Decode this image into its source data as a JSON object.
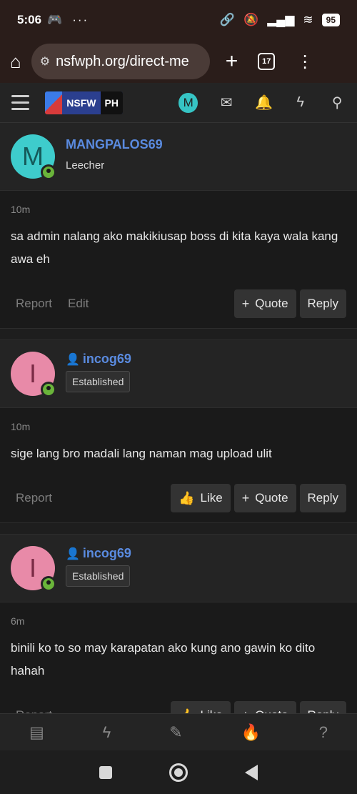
{
  "status_bar": {
    "time": "5:06",
    "dots": "···",
    "battery": "95"
  },
  "browser": {
    "url": "nsfwph.org/direct-me",
    "tabs_count": "17",
    "plus": "+",
    "kebab": "⋮"
  },
  "site": {
    "logo_nsfw": "NSFW",
    "logo_ph": "PH",
    "user_initial": "M"
  },
  "posts": [
    {
      "initial": "M",
      "username": "MANGPALOS69",
      "user_title": "Leecher",
      "timestamp": "10m",
      "message": "sa admin nalang ako makikiusap boss di kita kaya wala kang awa eh",
      "report": "Report",
      "edit": "Edit",
      "quote": "Quote",
      "reply": "Reply"
    },
    {
      "initial": "I",
      "username": "incog69",
      "badge": "Established",
      "timestamp": "10m",
      "message": "sige lang bro madali lang naman mag upload ulit",
      "report": "Report",
      "like": "Like",
      "quote": "Quote",
      "reply": "Reply"
    },
    {
      "initial": "I",
      "username": "incog69",
      "badge": "Established",
      "timestamp": "6m",
      "message": "binili ko to so may karapatan ako kung ano gawin ko dito hahah",
      "report": "Report",
      "like": "Like",
      "quote": "Quote",
      "reply": "Reply"
    }
  ],
  "colors": {
    "accent": "#5a8be0",
    "online": "#6ab43a",
    "teal_avatar": "#3ecccc",
    "pink_avatar": "#e88aa8"
  }
}
